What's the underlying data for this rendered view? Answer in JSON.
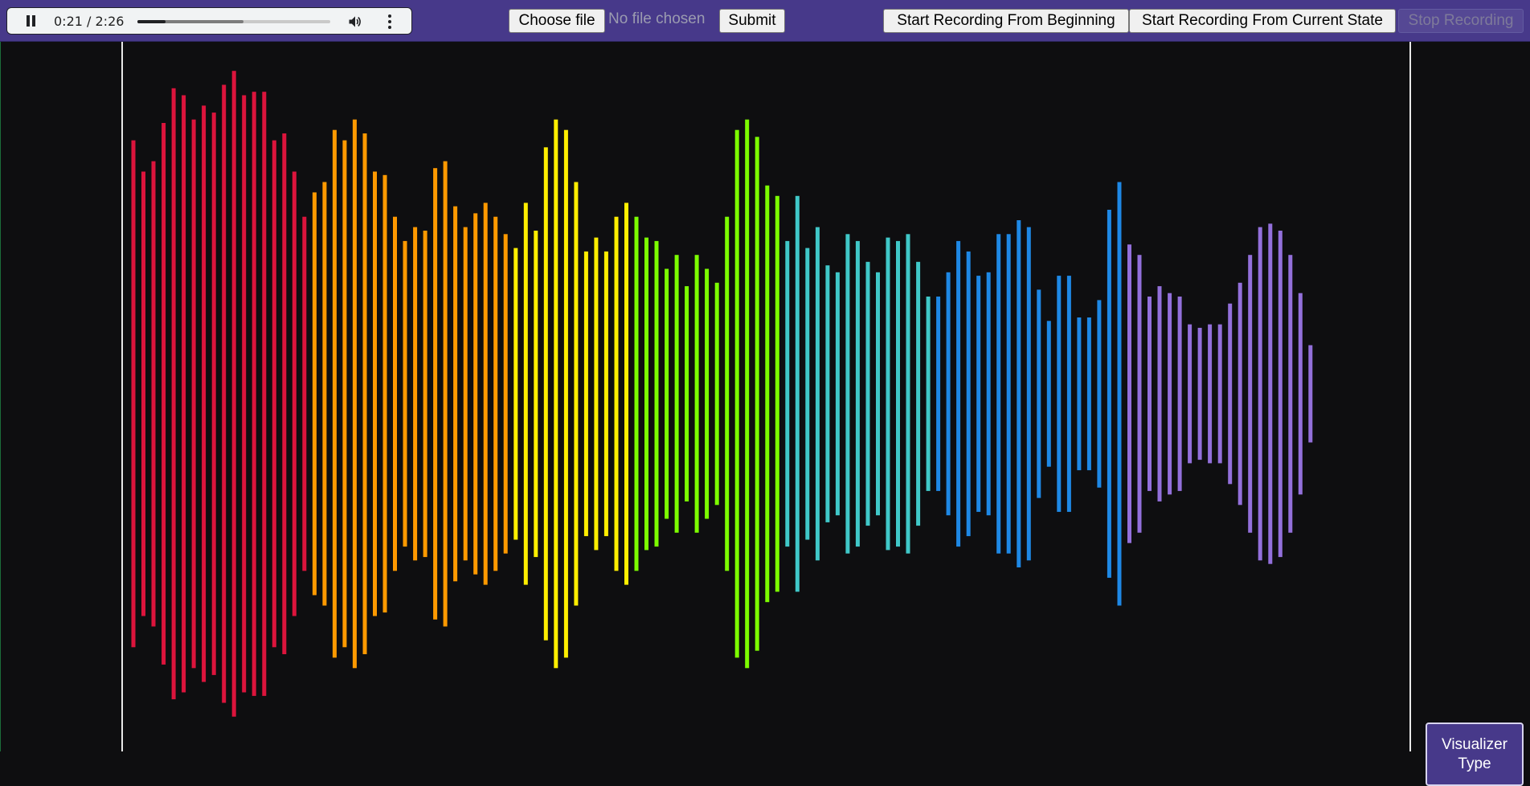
{
  "player": {
    "time_display": "0:21 / 2:26",
    "progress_fraction": 0.1438,
    "buffered_fraction": 0.55,
    "state": "playing",
    "icons": {
      "pause": "pause-icon",
      "volume": "volume-icon",
      "more": "more-vert-icon"
    }
  },
  "upload": {
    "choose_file_label": "Choose file",
    "file_status": "No file chosen",
    "submit_label": "Submit"
  },
  "recording": {
    "start_beginning_label": "Start Recording From Beginning",
    "start_current_label": "Start Recording From Current State",
    "stop_label": "Stop Recording",
    "stop_disabled": true
  },
  "visualizer": {
    "type_button_label": "Visualizer Type",
    "background": "#0e0e10",
    "bar_color_groups": [
      {
        "color": "#dc143c",
        "count": 18
      },
      {
        "color": "#ff9900",
        "count": 20
      },
      {
        "color": "#ffee00",
        "count": 12
      },
      {
        "color": "#7cfc00",
        "count": 15
      },
      {
        "color": "#40c8c8",
        "count": 15
      },
      {
        "color": "#1e88e5",
        "count": 19
      },
      {
        "color": "#9370db",
        "count": 17
      }
    ],
    "bar_levels": [
      0.73,
      0.64,
      0.67,
      0.78,
      0.88,
      0.86,
      0.79,
      0.83,
      0.81,
      0.89,
      0.93,
      0.86,
      0.87,
      0.87,
      0.73,
      0.75,
      0.64,
      0.51,
      0.58,
      0.61,
      0.76,
      0.73,
      0.79,
      0.75,
      0.64,
      0.63,
      0.51,
      0.44,
      0.48,
      0.47,
      0.65,
      0.67,
      0.54,
      0.48,
      0.52,
      0.55,
      0.51,
      0.46,
      0.42,
      0.55,
      0.47,
      0.71,
      0.79,
      0.76,
      0.61,
      0.41,
      0.45,
      0.41,
      0.51,
      0.55,
      0.51,
      0.45,
      0.44,
      0.36,
      0.4,
      0.31,
      0.4,
      0.36,
      0.32,
      0.51,
      0.76,
      0.79,
      0.74,
      0.6,
      0.57,
      0.44,
      0.57,
      0.42,
      0.48,
      0.37,
      0.35,
      0.46,
      0.44,
      0.38,
      0.35,
      0.45,
      0.44,
      0.46,
      0.38,
      0.28,
      0.28,
      0.35,
      0.44,
      0.41,
      0.34,
      0.35,
      0.46,
      0.46,
      0.5,
      0.48,
      0.3,
      0.21,
      0.34,
      0.34,
      0.22,
      0.22,
      0.27,
      0.53,
      0.61,
      0.43,
      0.4,
      0.28,
      0.31,
      0.29,
      0.28,
      0.2,
      0.19,
      0.2,
      0.2,
      0.26,
      0.32,
      0.4,
      0.48,
      0.49,
      0.47,
      0.4,
      0.29,
      0.14
    ]
  }
}
